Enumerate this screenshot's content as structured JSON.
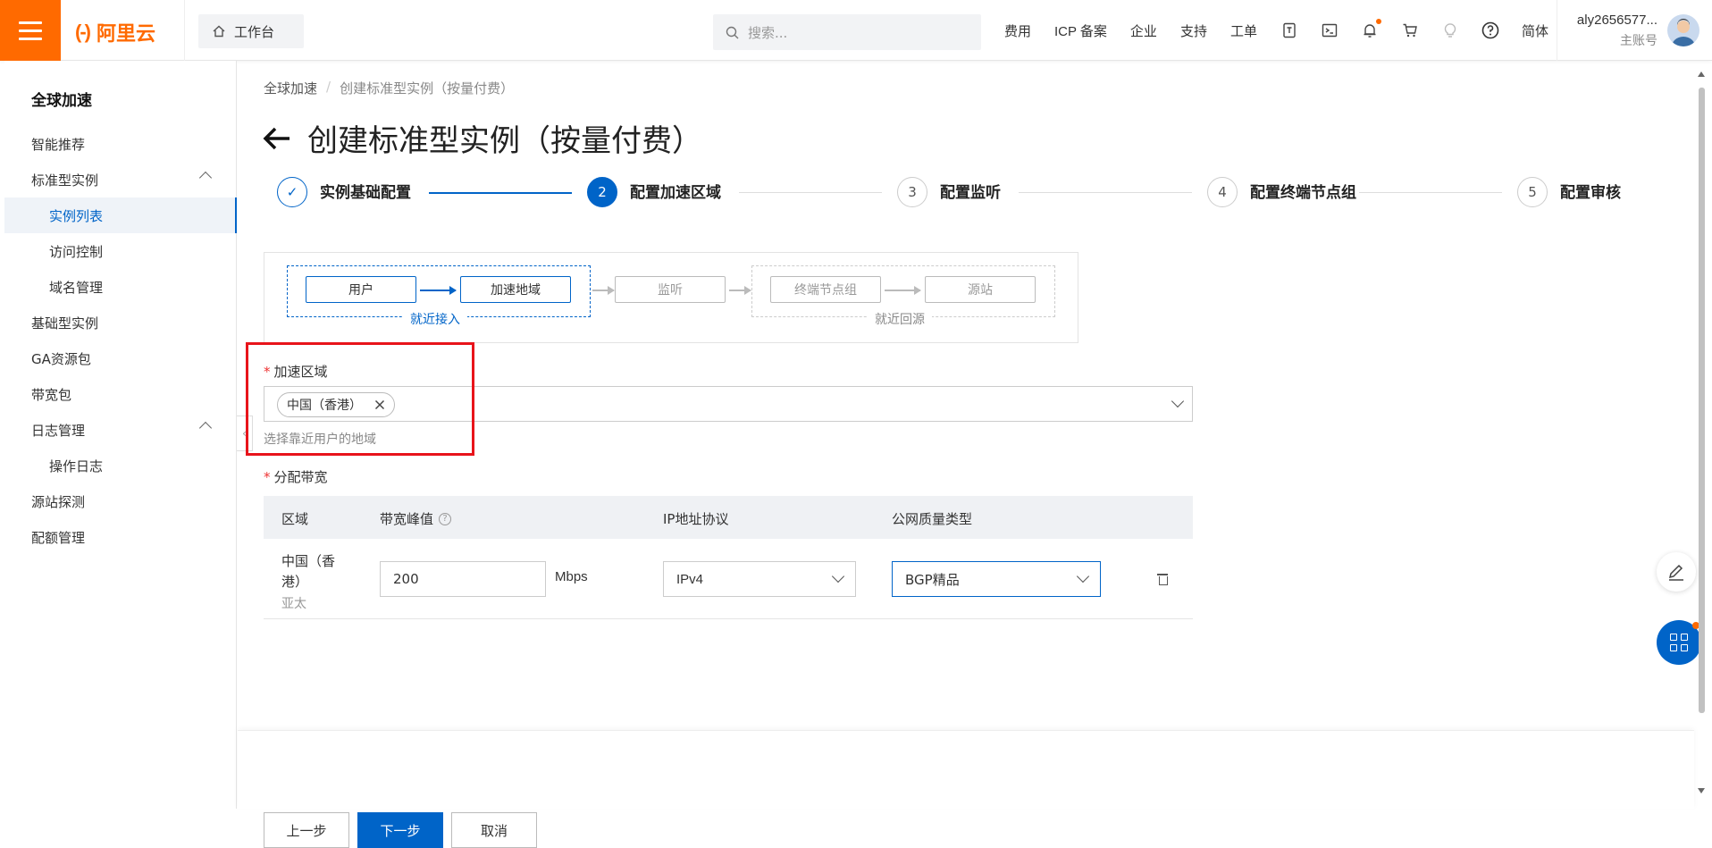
{
  "topbar": {
    "logo_mark": "(-)",
    "logo_text": "阿里云",
    "workbench": "工作台",
    "search_placeholder": "搜索...",
    "nav": [
      "费用",
      "ICP 备案",
      "企业",
      "支持",
      "工单"
    ],
    "lang": "简体",
    "account_name": "aly2656577...",
    "account_role": "主账号"
  },
  "sidebar": {
    "title": "全球加速",
    "items": [
      {
        "label": "智能推荐"
      },
      {
        "label": "标准型实例"
      },
      {
        "label": "实例列表"
      },
      {
        "label": "访问控制"
      },
      {
        "label": "域名管理"
      },
      {
        "label": "基础型实例"
      },
      {
        "label": "GA资源包"
      },
      {
        "label": "带宽包"
      },
      {
        "label": "日志管理"
      },
      {
        "label": "操作日志"
      },
      {
        "label": "源站探测"
      },
      {
        "label": "配额管理"
      }
    ]
  },
  "breadcrumb": {
    "root": "全球加速",
    "sep": "/",
    "current": "创建标准型实例（按量付费）"
  },
  "page": {
    "title": "创建标准型实例（按量付费）"
  },
  "steps": [
    {
      "num": "✓",
      "label": "实例基础配置",
      "state": "done"
    },
    {
      "num": "2",
      "label": "配置加速区域",
      "state": "active"
    },
    {
      "num": "3",
      "label": "配置监听",
      "state": "pending"
    },
    {
      "num": "4",
      "label": "配置终端节点组",
      "state": "pending"
    },
    {
      "num": "5",
      "label": "配置审核",
      "state": "pending"
    }
  ],
  "diagram": {
    "user": "用户",
    "region": "加速地域",
    "access_label": "就近接入",
    "listener": "监听",
    "endpoint_group": "终端节点组",
    "origin": "源站",
    "return_label": "就近回源"
  },
  "form": {
    "region_label": "加速区域",
    "required_mark": "*",
    "selected_tag": "中国（香港）",
    "region_hint": "选择靠近用户的地域",
    "bandwidth_label": "分配带宽"
  },
  "table": {
    "headers": [
      "区域",
      "带宽峰值",
      "IP地址协议",
      "公网质量类型"
    ],
    "row": {
      "region": "中国（香港）",
      "region_sub": "亚太",
      "bandwidth": "200",
      "unit": "Mbps",
      "ip_protocol": "IPv4",
      "quality": "BGP精品"
    }
  },
  "footer": {
    "prev": "上一步",
    "next": "下一步",
    "cancel": "取消"
  },
  "colors": {
    "brand": "#ff6a00",
    "primary": "#0064c8",
    "highlight": "#e8141b"
  }
}
